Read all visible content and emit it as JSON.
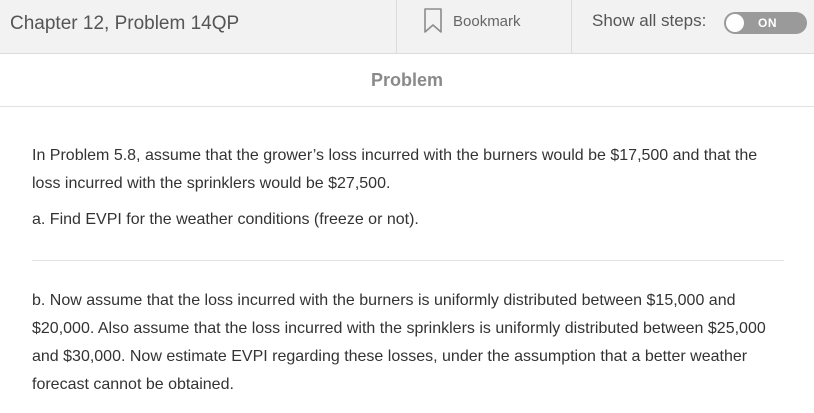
{
  "header": {
    "title": "Chapter 12, Problem 14QP",
    "bookmark_label": "Bookmark",
    "steps_label": "Show all steps:",
    "toggle_state": "ON"
  },
  "problem": {
    "heading": "Problem",
    "intro": "In Problem 5.8, assume that the grower’s loss incurred with the burners would be $17,500 and that the loss incurred with the sprinklers would be $27,500.",
    "part_a": "a. Find EVPI for the weather conditions (freeze or not).",
    "part_b": "b. Now assume that the loss incurred with the burners is uniformly distributed between $15,000 and $20,000. Also assume that the loss incurred with the sprinklers is uniformly distributed between $25,000 and $30,000. Now estimate EVPI regarding these losses, under the assumption that a better weather forecast cannot be obtained."
  },
  "icons": {
    "bookmark": "bookmark-icon"
  },
  "colors": {
    "header_bg": "#f2f2f2",
    "toggle_bg": "#9a9a9a",
    "heading_text": "#8a8a8a"
  }
}
